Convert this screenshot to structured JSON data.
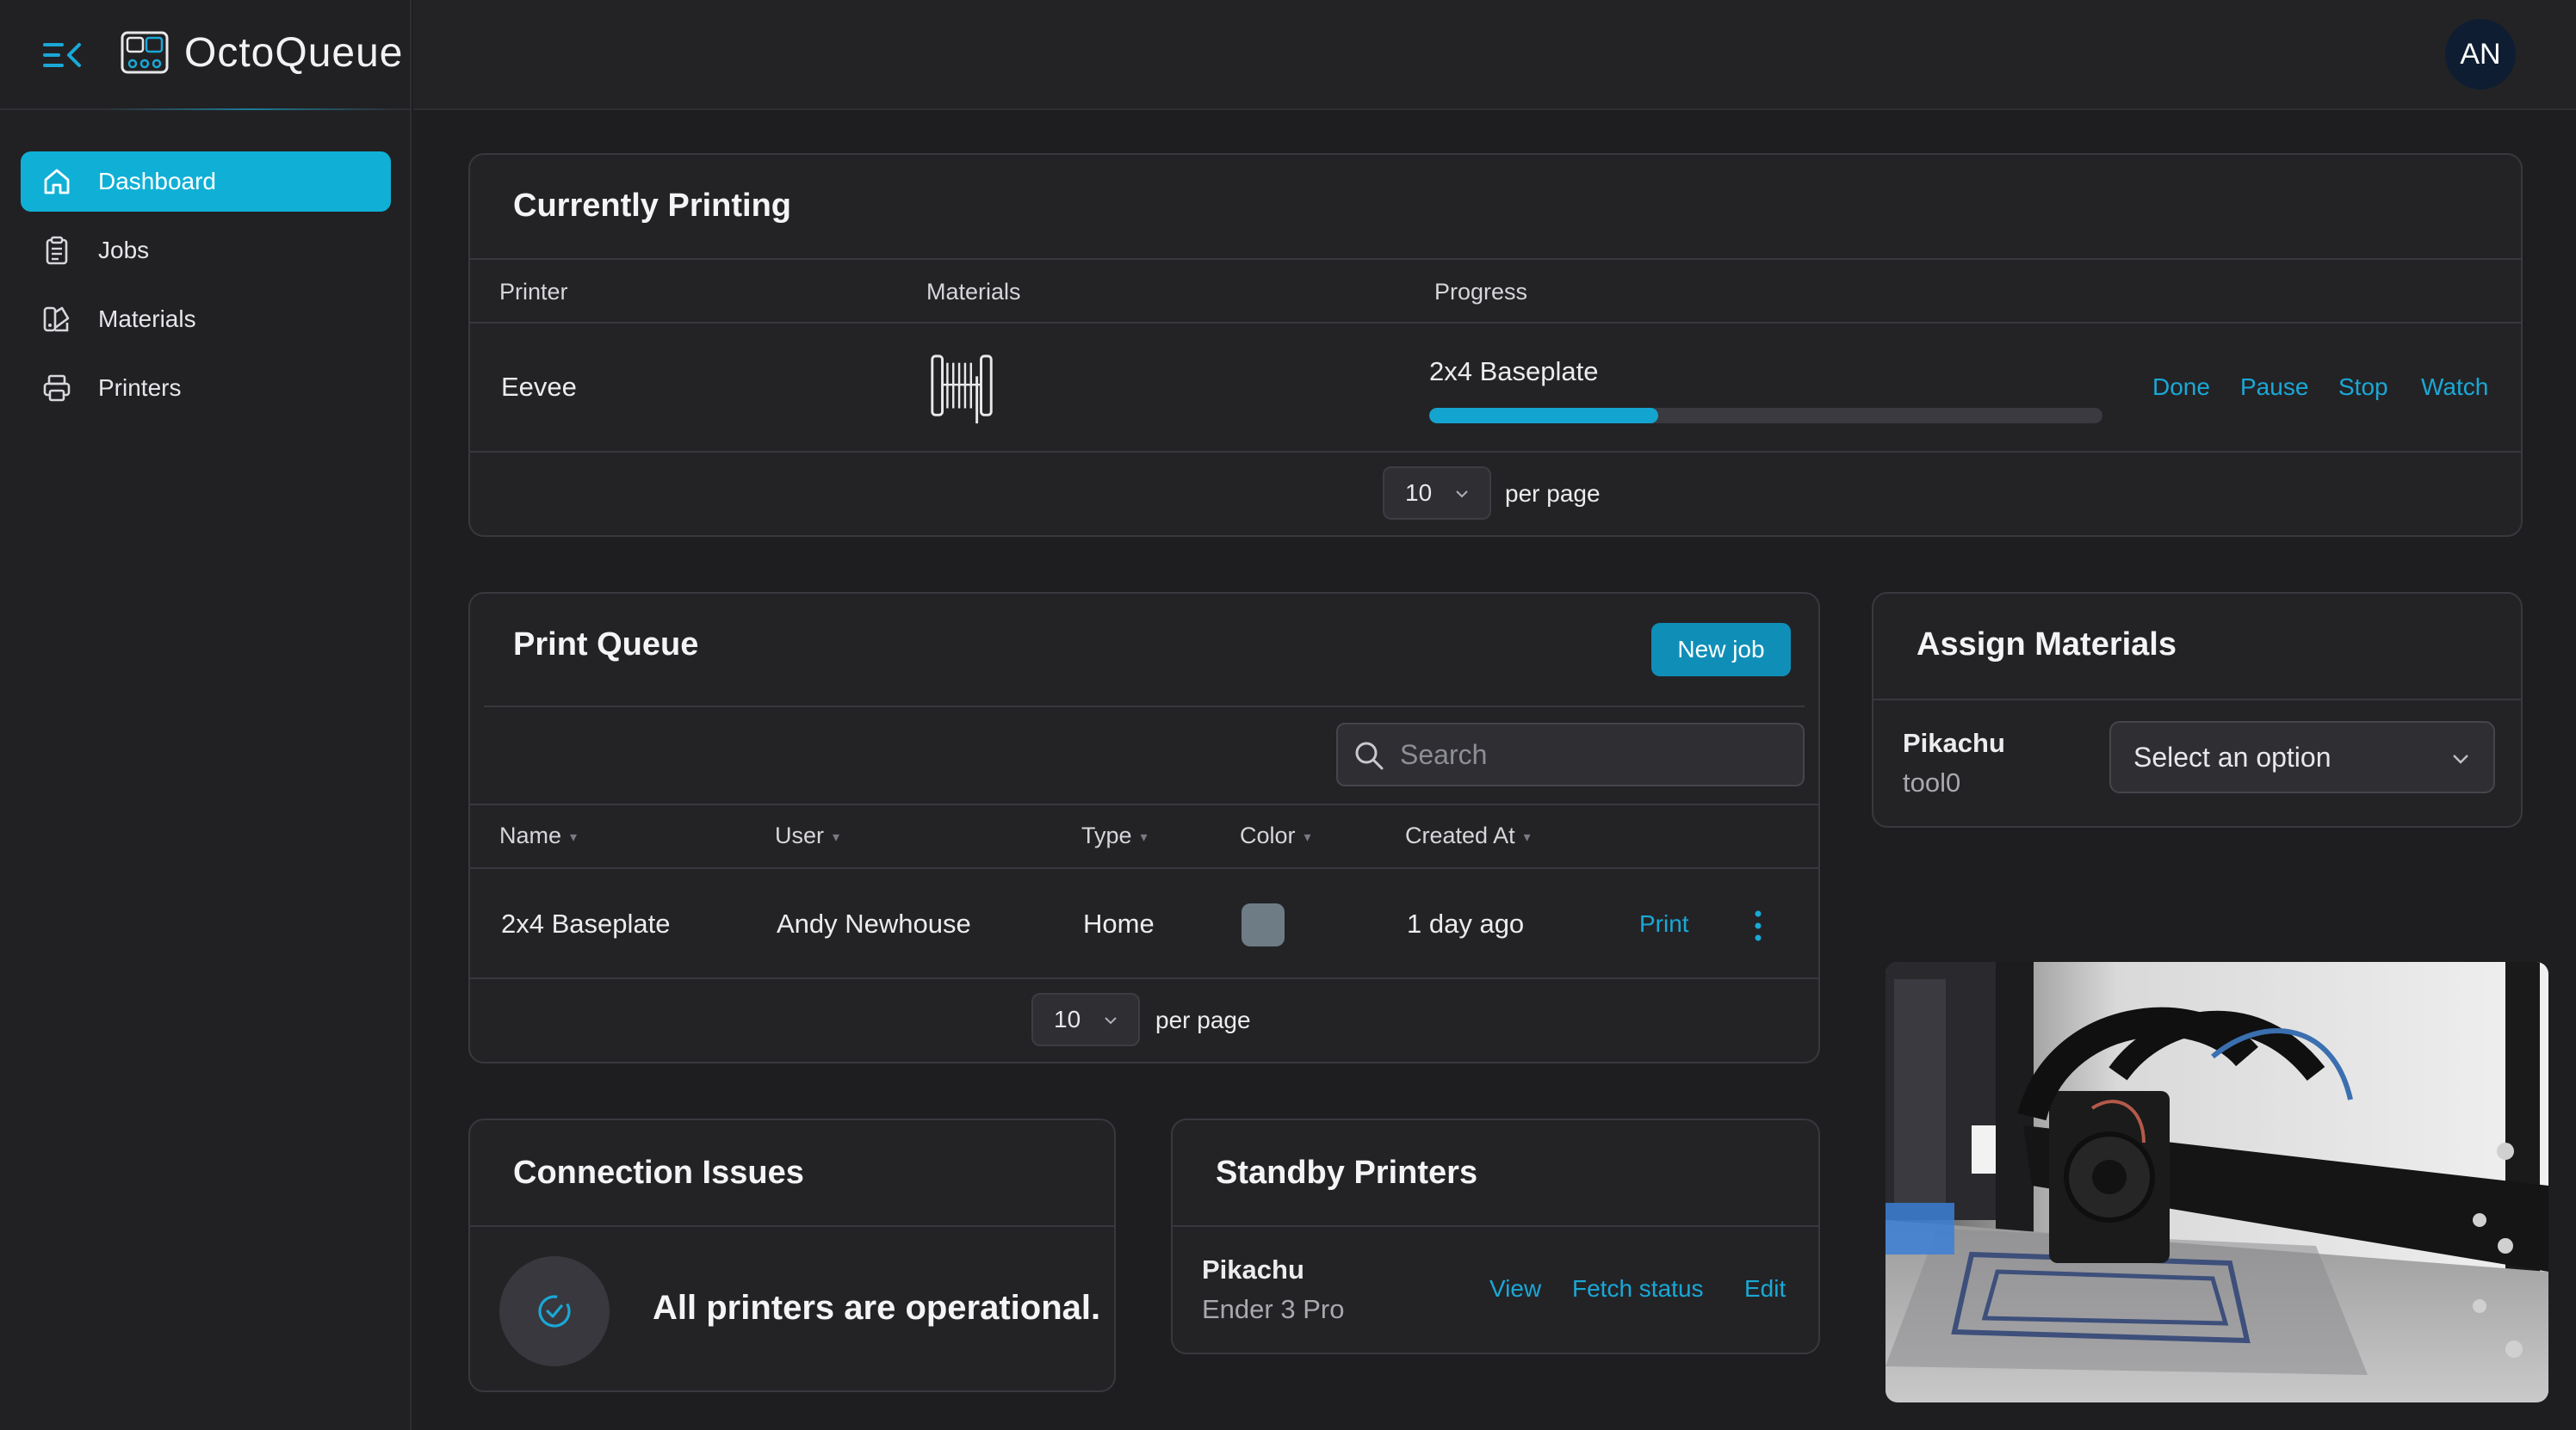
{
  "app": {
    "name": "OctoQueue"
  },
  "user": {
    "initials": "AN"
  },
  "sidebar": {
    "items": [
      {
        "label": "Dashboard",
        "icon": "home-icon",
        "active": true
      },
      {
        "label": "Jobs",
        "icon": "clipboard-icon"
      },
      {
        "label": "Materials",
        "icon": "swatch-book-icon"
      },
      {
        "label": "Printers",
        "icon": "printer-icon"
      }
    ]
  },
  "currently_printing": {
    "title": "Currently Printing",
    "columns": [
      "Printer",
      "Materials",
      "Progress"
    ],
    "rows": [
      {
        "printer": "Eevee",
        "materials_icon": "filament-spool-icon",
        "job": "2x4 Baseplate",
        "progress": 0.34,
        "actions": [
          "Done",
          "Pause",
          "Stop",
          "Watch"
        ]
      }
    ],
    "per_page": "10",
    "per_page_label": "per page"
  },
  "print_queue": {
    "title": "Print Queue",
    "new_job_label": "New job",
    "search_placeholder": "Search",
    "columns": [
      "Name",
      "User",
      "Type",
      "Color",
      "Created At"
    ],
    "rows": [
      {
        "name": "2x4 Baseplate",
        "user": "Andy Newhouse",
        "type": "Home",
        "color": "#6e7c86",
        "created_at": "1 day ago",
        "action": "Print"
      }
    ],
    "per_page": "10",
    "per_page_label": "per page"
  },
  "assign_materials": {
    "title": "Assign Materials",
    "printer": "Pikachu",
    "tool": "tool0",
    "select_placeholder": "Select an option"
  },
  "connection_issues": {
    "title": "Connection Issues",
    "message": "All printers are operational."
  },
  "standby_printers": {
    "title": "Standby Printers",
    "printers": [
      {
        "name": "Pikachu",
        "model": "Ender 3 Pro",
        "actions": [
          "View",
          "Fetch status",
          "Edit"
        ]
      }
    ]
  },
  "colors": {
    "accent": "#10b0d6",
    "link": "#1aa8d6",
    "background": "#1e1e21",
    "card": "#232326"
  }
}
